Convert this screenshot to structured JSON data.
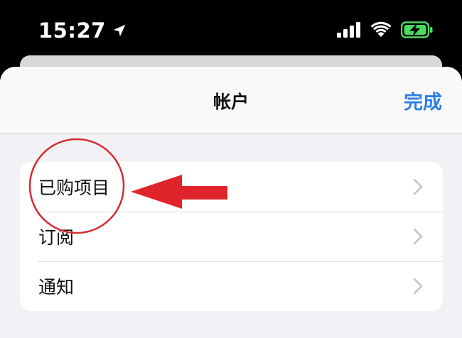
{
  "status_bar": {
    "time": "15:27"
  },
  "nav": {
    "title": "帐户",
    "done_label": "完成"
  },
  "list": {
    "items": [
      {
        "label": "已购项目"
      },
      {
        "label": "订阅"
      },
      {
        "label": "通知"
      }
    ]
  },
  "colors": {
    "accent": "#2f7ee0",
    "annotation_red": "#e0242b",
    "battery_green": "#4cd964"
  },
  "icons": {
    "location": "location-arrow-icon",
    "signal": "cellular-signal-icon",
    "wifi": "wifi-icon",
    "battery": "battery-charging-icon",
    "chevron": "chevron-right-icon"
  }
}
